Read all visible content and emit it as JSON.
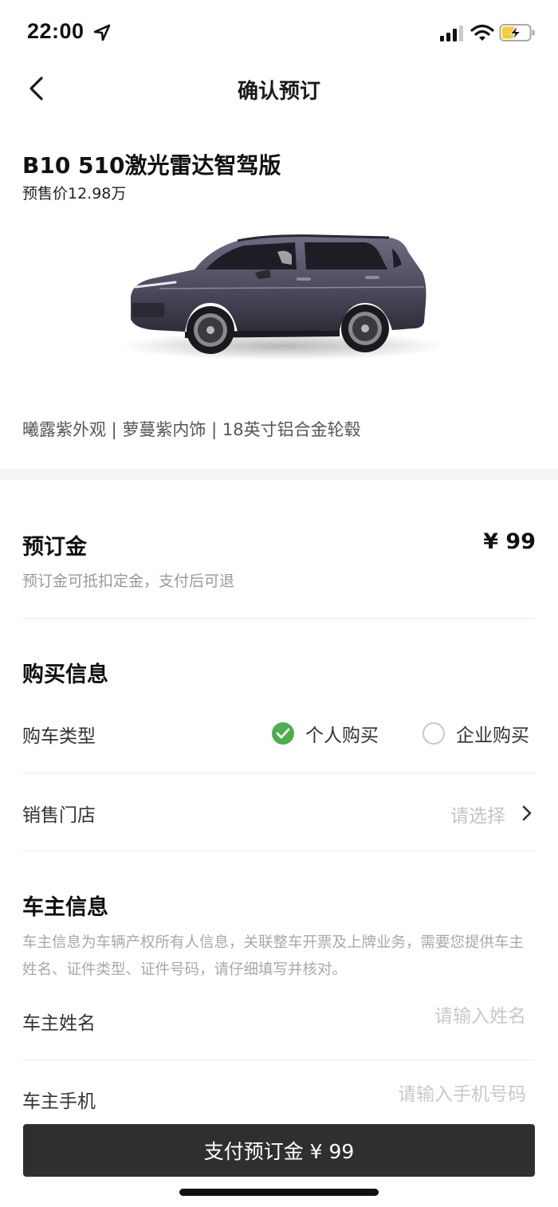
{
  "status_bar": {
    "time": "22:00",
    "icons": [
      "location-arrow-icon",
      "signal-icon",
      "wifi-icon",
      "battery-charging-icon"
    ]
  },
  "nav": {
    "title": "确认预订",
    "back_icon": "chevron-left-icon"
  },
  "product": {
    "name": "B10 510激光雷达智驾版",
    "price": "预售价12.98万",
    "image": "car-image",
    "spec": "曦露紫外观 | 萝蔓紫内饰 | 18英寸铝合金轮毂"
  },
  "deposit": {
    "label": "预订金",
    "amount": "¥ 99",
    "note": "预订金可抵扣定金，支付后可退"
  },
  "purchase_info": {
    "title": "购买信息",
    "type_label": "购车类型",
    "options": [
      {
        "label": "个人购买",
        "selected": true
      },
      {
        "label": "企业购买",
        "selected": false
      }
    ],
    "store_label": "销售门店",
    "store_placeholder": "请选择"
  },
  "owner_info": {
    "title": "车主信息",
    "description": "车主信息为车辆产权所有人信息，关联整车开票及上牌业务，需要您提供车主姓名、证件类型、证件号码，请仔细填写并核对。",
    "name_label": "车主姓名",
    "name_placeholder": "请输入姓名",
    "name_value": "",
    "phone_label": "车主手机",
    "phone_placeholder": "请输入手机号码",
    "phone_value": ""
  },
  "pay_button": {
    "label": "支付预订金 ¥ 99"
  },
  "colors": {
    "accent_check": "#4cae4c",
    "button_bg": "#2f2f2f",
    "placeholder": "#c4c4c4"
  }
}
